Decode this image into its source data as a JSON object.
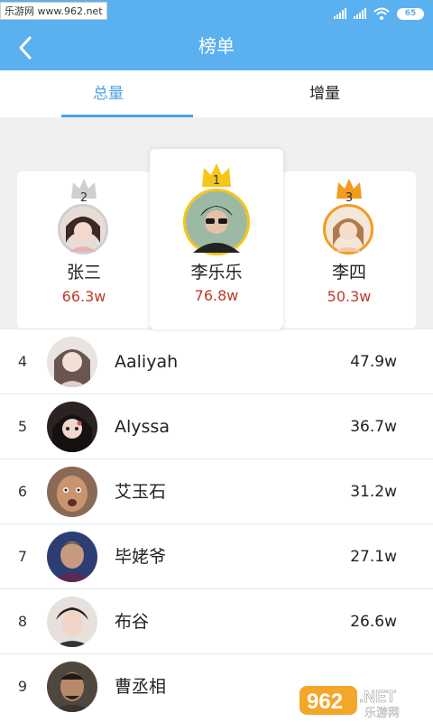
{
  "status_bar": {
    "watermark": "乐游网 www.962.net",
    "battery": "65"
  },
  "header": {
    "title": "榜单"
  },
  "tabs": [
    {
      "label": "总量",
      "active": true
    },
    {
      "label": "增量",
      "active": false
    }
  ],
  "podium": [
    {
      "rank": "2",
      "name": "张三",
      "score": "66.3w",
      "crown_color": "#c9c9c9"
    },
    {
      "rank": "1",
      "name": "李乐乐",
      "score": "76.8w",
      "crown_color": "#f5c518"
    },
    {
      "rank": "3",
      "name": "李四",
      "score": "50.3w",
      "crown_color": "#f29b1d"
    }
  ],
  "list": [
    {
      "rank": "4",
      "name": "Aaliyah",
      "score": "47.9w"
    },
    {
      "rank": "5",
      "name": "Alyssa",
      "score": "36.7w"
    },
    {
      "rank": "6",
      "name": "艾玉石",
      "score": "31.2w"
    },
    {
      "rank": "7",
      "name": "毕姥爷",
      "score": "27.1w"
    },
    {
      "rank": "8",
      "name": "布谷",
      "score": "26.6w"
    },
    {
      "rank": "9",
      "name": "曹丞相",
      "score": ""
    }
  ],
  "bottom_watermark": {
    "brand": "962",
    "suffix": ".NET",
    "sub": "乐游网"
  },
  "colors": {
    "accent": "#5bb0ef",
    "score": "#c0392b"
  }
}
